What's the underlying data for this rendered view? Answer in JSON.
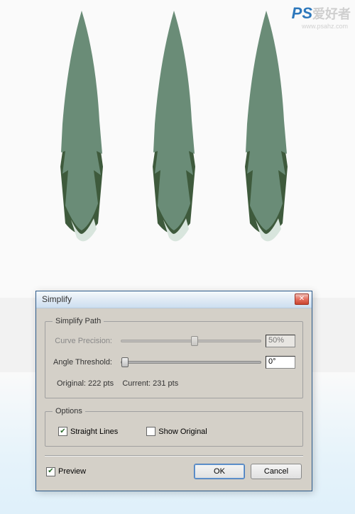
{
  "watermark": {
    "logo": "PS",
    "text": "爱好者",
    "url": "www.psahz.com"
  },
  "dialog": {
    "title": "Simplify",
    "close_glyph": "✕",
    "simplify_path": {
      "legend": "Simplify Path",
      "curve_precision_label": "Curve Precision:",
      "curve_precision_value": "50%",
      "angle_threshold_label": "Angle Threshold:",
      "angle_threshold_value": "0°",
      "stats": "Original: 222 pts    Current: 231 pts"
    },
    "options": {
      "legend": "Options",
      "straight_lines_label": "Straight Lines",
      "straight_lines_checked": true,
      "show_original_label": "Show Original",
      "show_original_checked": false
    },
    "preview_label": "Preview",
    "preview_checked": true,
    "ok_label": "OK",
    "cancel_label": "Cancel"
  },
  "checkmark_glyph": "✔"
}
